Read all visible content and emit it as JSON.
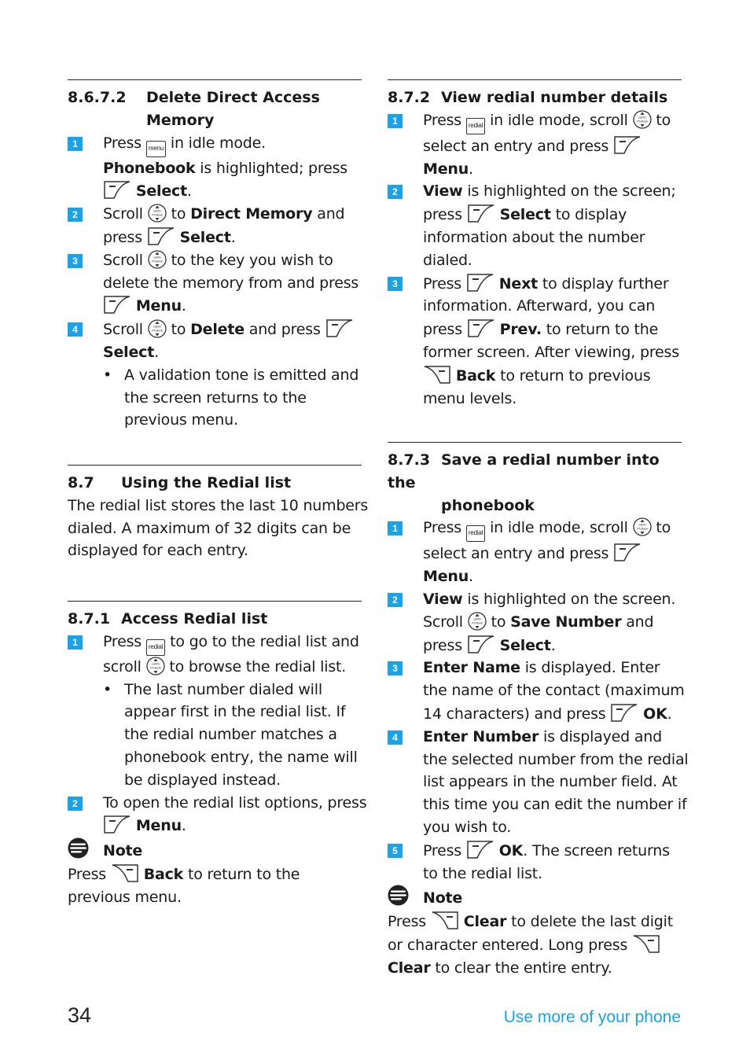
{
  "page": {
    "number": "34",
    "chapter_title": "Use more of your phone",
    "accent_color": "#1aa3e8"
  },
  "icons": {
    "menu_key": "menu",
    "redial_key": "redial",
    "nav_key_top": "call ID",
    "nav_key_bottom": "Ph.Book"
  },
  "s8672": {
    "num": "8.6.7.2",
    "title1": "Delete Direct Access",
    "title2": "Memory",
    "steps": [
      {
        "n": "1"
      },
      {
        "n": "2"
      },
      {
        "n": "3"
      },
      {
        "n": "4"
      }
    ],
    "t": {
      "press": "Press",
      "idle": " in idle mode.",
      "phonebook": "Phonebook",
      "highlighted_press": " is highlighted; press",
      "select": "Select",
      "dot": ".",
      "scroll": "Scroll",
      "to": " to ",
      "direct_memory": "Direct Memory",
      "and": " and",
      "press2": "press",
      "key_wish": " to the key you wish to",
      "delete_from": "delete the memory from and press",
      "menu": "Menu",
      "delete": "Delete",
      "and_press": " and press",
      "bullet": "•",
      "b1": "A validation tone is emitted and",
      "b2": "the screen returns to the",
      "b3": "previous menu."
    }
  },
  "s87": {
    "num": "8.7",
    "title": "Using the Redial list",
    "p1": "The redial list stores the last 10 numbers",
    "p2": "dialed. A maximum of 32 digits can be",
    "p3": "displayed for each entry."
  },
  "s871": {
    "num": "8.7.1",
    "title": "Access Redial list",
    "steps": [
      {
        "n": "1"
      },
      {
        "n": "2"
      }
    ],
    "t": {
      "press": "Press",
      "go": " to go to the redial list and",
      "scroll": "scroll",
      "browse": " to browse the redial list.",
      "bullet": "•",
      "b1": "The last number dialed will",
      "b2": "appear first in the redial list. If",
      "b3": "the redial number matches a",
      "b4": "phonebook entry, the name will",
      "b5": "be displayed instead.",
      "open": "To open the redial list options, press",
      "menu": "Menu",
      "dot": ".",
      "note": "Note",
      "note_press": "Press",
      "back": "Back",
      "note_rest": " to return to the",
      "note_l2": "previous menu."
    }
  },
  "s872": {
    "num": "8.7.2",
    "title": "View redial number details",
    "steps": [
      {
        "n": "1"
      },
      {
        "n": "2"
      },
      {
        "n": "3"
      }
    ],
    "t": {
      "press": "Press",
      "idle_scroll": " in idle mode, scroll",
      "to": " to",
      "select_entry": "select an entry and press",
      "menu": "Menu",
      "dot": ".",
      "view": "View",
      "highlighted": " is highlighted on the screen;",
      "press2": "press",
      "select": "Select",
      "to_display": " to display",
      "info": "information about the number",
      "dialed": "dialed.",
      "next": "Next",
      "further": " to display further",
      "afterward": "information. Afterward, you can",
      "prev": "Prev.",
      "return_to_the": " to return to the",
      "former": "former screen. After viewing, press",
      "back": "Back",
      "return_prev": " to return to previous",
      "levels": "menu levels."
    }
  },
  "s873": {
    "num": "8.7.3",
    "title1": "Save a redial number into the",
    "title2": "phonebook",
    "steps": [
      {
        "n": "1"
      },
      {
        "n": "2"
      },
      {
        "n": "3"
      },
      {
        "n": "4"
      },
      {
        "n": "5"
      }
    ],
    "t": {
      "press": "Press",
      "idle_scroll": " in idle mode, scroll",
      "to": " to",
      "select_entry": "select an entry and press",
      "menu": "Menu",
      "dot": ".",
      "view": "View",
      "highlighted": " is highlighted on the screen.",
      "scroll": "Scroll",
      "to2": " to ",
      "save_number": "Save Number",
      "and": " and",
      "press2": "press",
      "select": "Select",
      "enter_name": "Enter Name",
      "displayed_enter": " is displayed. Enter",
      "name_contact": "the name of the contact (maximum",
      "chars": "14 characters) and press",
      "ok": "OK",
      "enter_number": "Enter Number",
      "displayed_and": " is displayed and",
      "selected": "the selected number from the redial",
      "list_appears": "list appears in the number field. At",
      "this_time": "this time you can edit the number if",
      "wish": "you wish to.",
      "screen_returns": ". The screen returns",
      "to_list": "to the redial list.",
      "note": "Note",
      "note_press": "Press",
      "clear": "Clear",
      "delete_last": " to delete the last digit",
      "or_char": "or character entered. Long press",
      "clear_entire": " to clear the entire entry."
    }
  }
}
